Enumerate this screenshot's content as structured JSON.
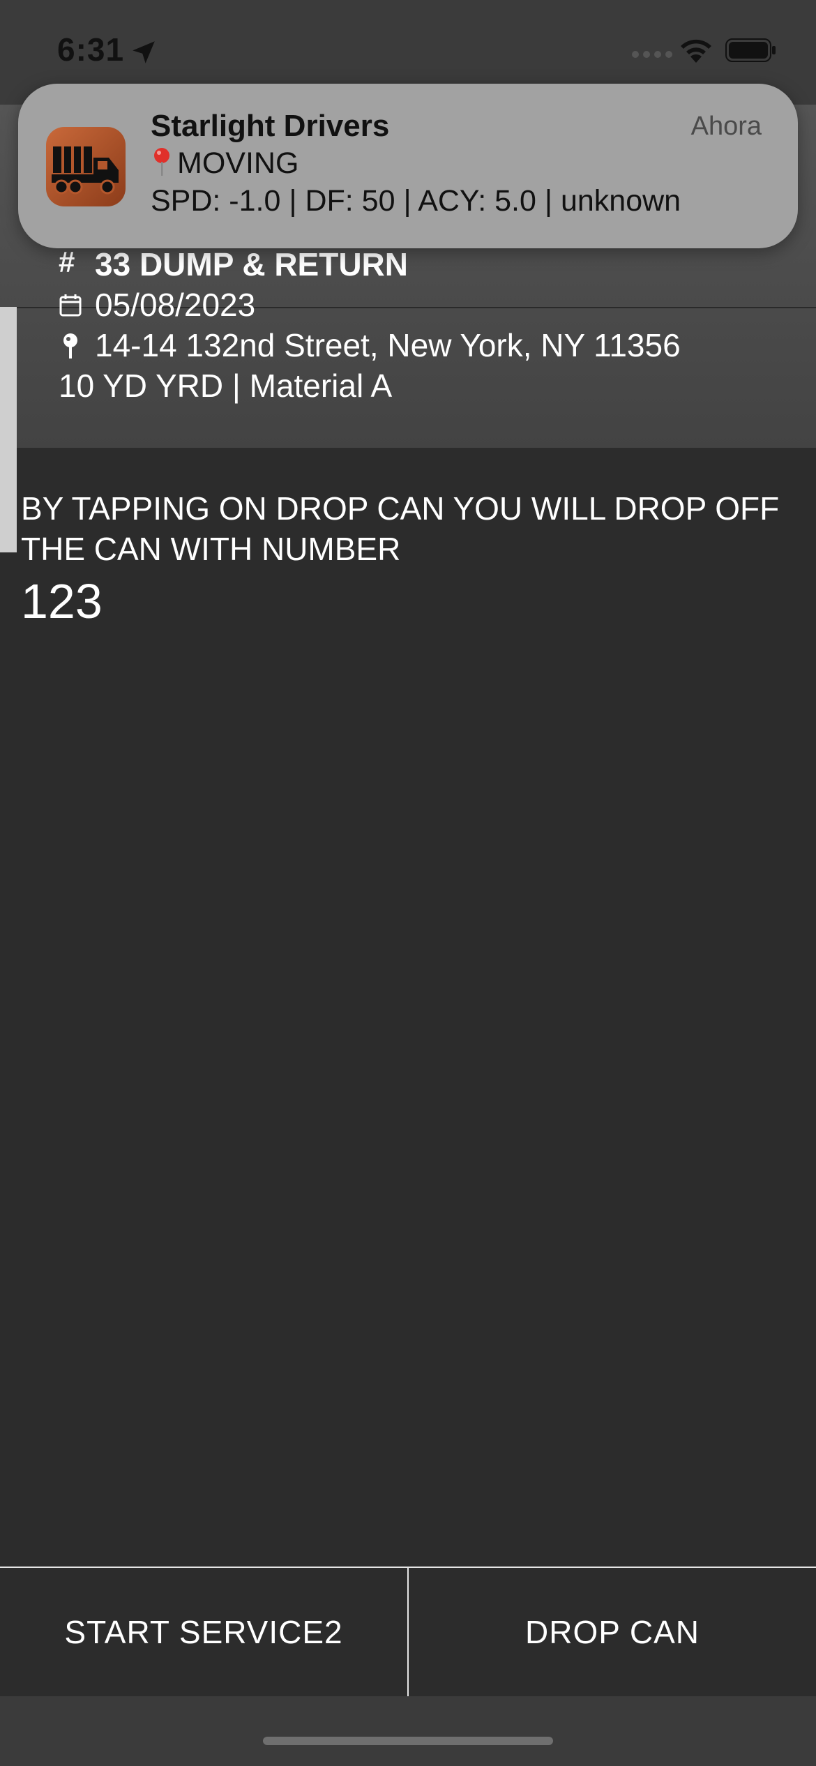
{
  "status_bar": {
    "time": "6:31"
  },
  "notification": {
    "app_name": "Starlight Drivers",
    "time_label": "Ahora",
    "status_line": "MOVING",
    "detail_line": "SPD: -1.0 | DF: 50 | ACY: 5.0 | unknown",
    "status_emoji": "red-pin-icon"
  },
  "job": {
    "number": "33 DUMP & RETURN",
    "date": "05/08/2023",
    "address": "14-14 132nd Street, New York, NY 11356",
    "material": "10 YD YRD | Material A"
  },
  "notice": {
    "text": "BY TAPPING ON DROP CAN YOU WILL DROP OFF THE CAN WITH NUMBER",
    "can_number": "123"
  },
  "actions": {
    "left_label": "START SERVICE2",
    "right_label": "DROP CAN"
  },
  "colors": {
    "background": "#2c2c2c",
    "header": "#4a4a4a",
    "notification": "#a2a2a2",
    "app_icon": "#b4572c"
  }
}
